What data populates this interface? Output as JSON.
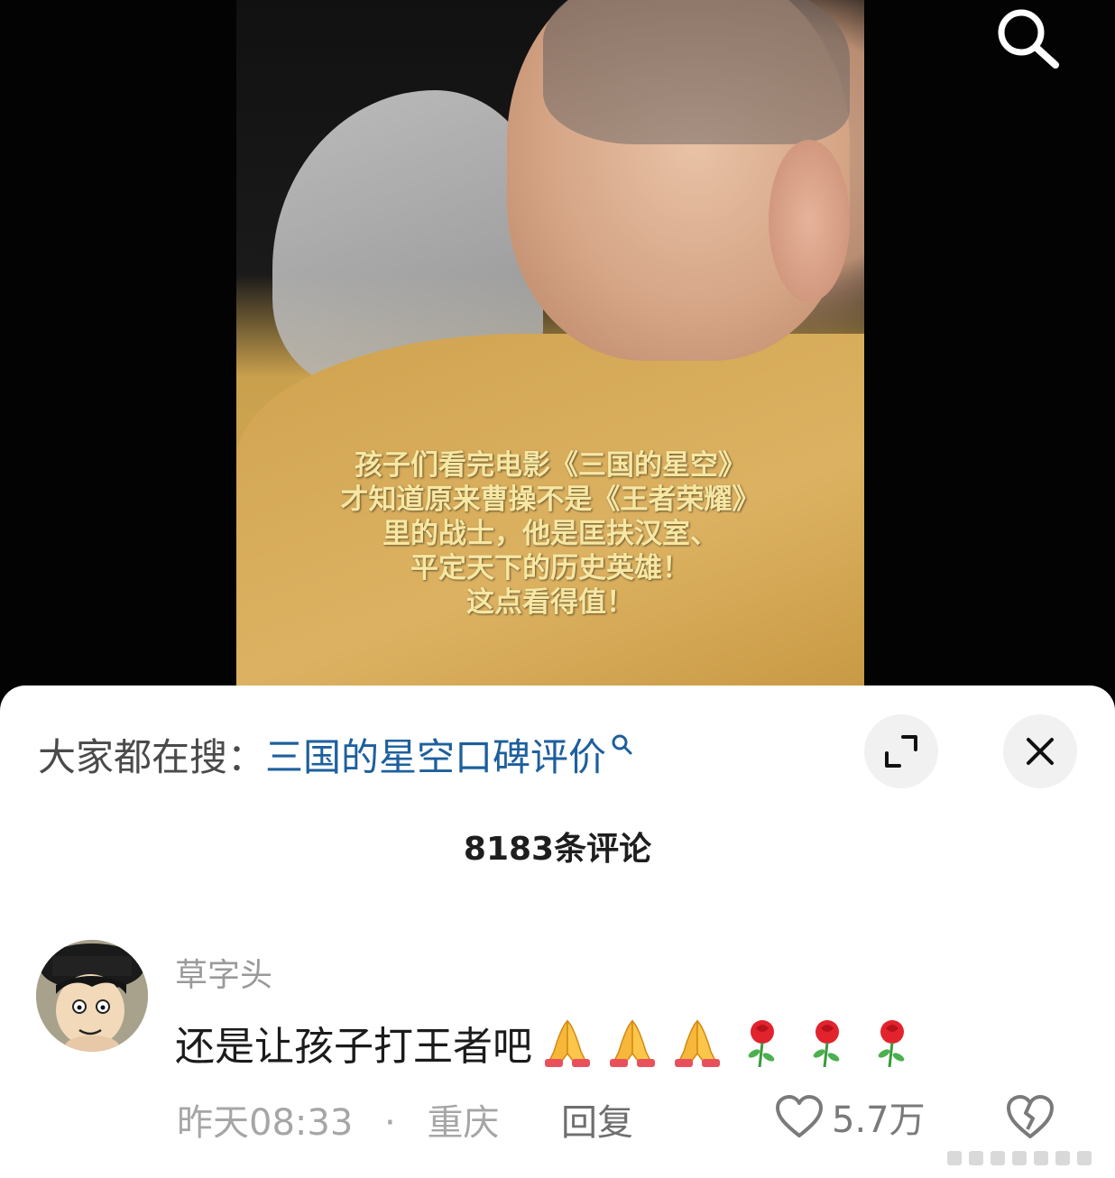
{
  "video": {
    "caption_lines": [
      "孩子们看完电影《三国的星空》",
      "才知道原来曹操不是《王者荣耀》",
      "里的战士，他是匡扶汉室、",
      "平定天下的历史英雄！",
      "这点看得值！"
    ],
    "search_icon": "search-icon"
  },
  "search_hint": {
    "prefix": "大家都在搜：",
    "query": "三国的星空口碑评价",
    "query_color": "#1d5f9d"
  },
  "header": {
    "comment_count": "8183条评论",
    "expand_icon": "expand-icon",
    "close_icon": "close-icon"
  },
  "comment": {
    "username": "草字头",
    "text": "还是让孩子打王者吧",
    "emojis": [
      "pray-emoji",
      "pray-emoji",
      "pray-emoji",
      "rose-emoji",
      "rose-emoji",
      "rose-emoji"
    ],
    "time": "昨天08:33",
    "separator": "·",
    "location": "重庆",
    "reply_label": "回复",
    "like_count": "5.7万"
  }
}
